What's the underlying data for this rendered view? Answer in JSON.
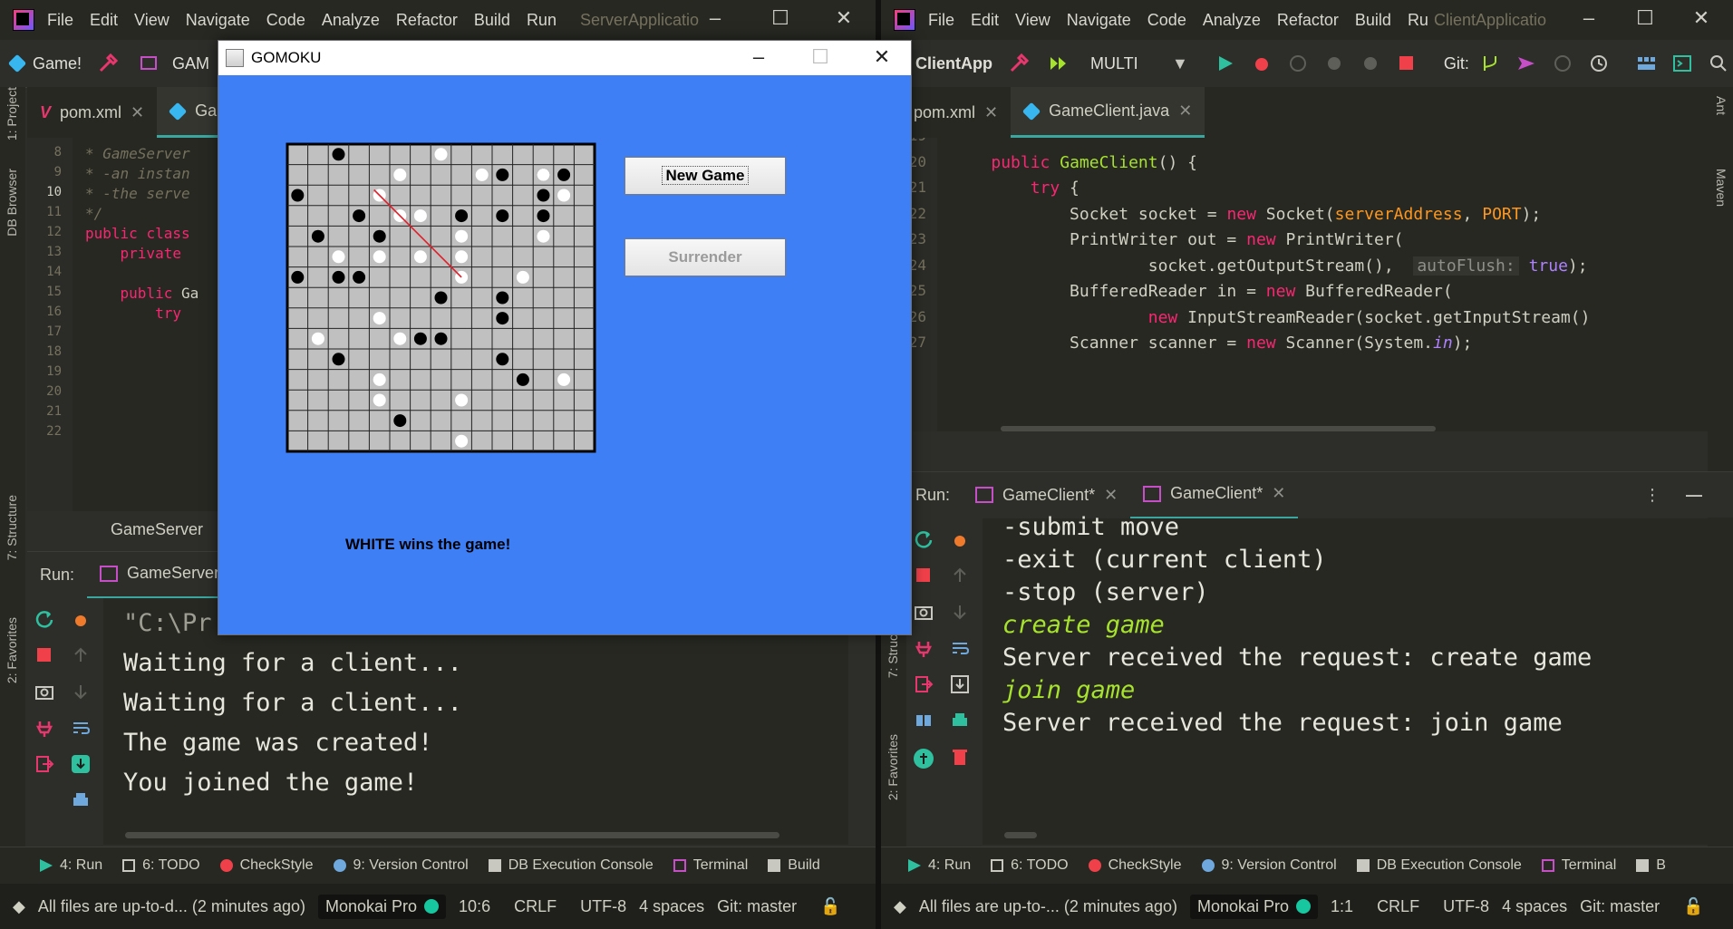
{
  "left_window": {
    "menu": [
      "File",
      "Edit",
      "View",
      "Navigate",
      "Code",
      "Analyze",
      "Refactor",
      "Build",
      "Run"
    ],
    "title": "ServerApplicatio",
    "toolbar": {
      "project": "Game!",
      "config": "GAM"
    },
    "tabs": [
      {
        "label": "pom.xml"
      },
      {
        "label": "Gar"
      }
    ],
    "side_labels": {
      "project": "1: Project",
      "db": "DB Browser",
      "structure": "7: Structure",
      "favorites": "2: Favorites"
    },
    "editor": {
      "line_numbers": [
        "8",
        "9",
        "10",
        "11",
        "12",
        "13",
        "14",
        "15",
        "16",
        "17",
        "18",
        "19",
        "20",
        "21",
        "22"
      ],
      "lines": [
        "* GameServer",
        "* -an instan",
        "* -the serve",
        "*/",
        "public class",
        "    private ",
        "",
        "    public Ga",
        "        try ",
        "",
        "",
        "",
        "",
        "",
        ""
      ],
      "breadcrumb": "GameServer"
    },
    "run": {
      "label": "Run:",
      "tab": "GameServer",
      "console": [
        "\"C:\\Pr",
        "Waiting for a client...",
        "Waiting for a client...",
        "The game was created!",
        "You joined the game!"
      ]
    },
    "toolwindows": [
      "4: Run",
      "6: TODO",
      "CheckStyle",
      "9: Version Control",
      "DB Execution Console",
      "Terminal",
      "Build"
    ],
    "status": {
      "message": "All files are up-to-d... (2 minutes ago)",
      "theme": "Monokai Pro",
      "pos": "10:6",
      "crlf": "CRLF",
      "enc": "UTF-8",
      "indent": "4 spaces",
      "git": "Git: master"
    }
  },
  "right_window": {
    "menu": [
      "File",
      "Edit",
      "View",
      "Navigate",
      "Code",
      "Analyze",
      "Refactor",
      "Build",
      "Ru"
    ],
    "title": "ClientApplicatio",
    "toolbar": {
      "project": "ClientApp",
      "config": "MULTI",
      "git": "Git:"
    },
    "tabs": [
      {
        "label": "pom.xml"
      },
      {
        "label": "GameClient.java"
      }
    ],
    "side_labels": {
      "ant": "Ant",
      "maven": "Maven",
      "structure": "7: Struc",
      "favorites": "2: Favorites"
    },
    "editor": {
      "line_numbers": [
        "19",
        "20",
        "21",
        "22",
        "23",
        "24",
        "25",
        "26",
        "27"
      ],
      "lines": [
        "",
        "    public GameClient() {",
        "        try {",
        "            Socket socket = new Socket(serverAddress, PORT);",
        "            PrintWriter out = new PrintWriter(",
        "                    socket.getOutputStream(),  autoFlush: true);",
        "            BufferedReader in = new BufferedReader(",
        "                    new InputStreamReader(socket.getInputStream()",
        "            Scanner scanner = new Scanner(System.in);"
      ]
    },
    "run": {
      "label": "Run:",
      "tabs": [
        "GameClient*",
        "GameClient*"
      ],
      "console": [
        {
          "text": "-submit move",
          "style": "normal"
        },
        {
          "text": "-exit (current client)",
          "style": "normal"
        },
        {
          "text": "-stop (server)",
          "style": "normal"
        },
        {
          "text": "create game",
          "style": "green"
        },
        {
          "text": "Server received the request: create game",
          "style": "normal"
        },
        {
          "text": "join game",
          "style": "green"
        },
        {
          "text": "Server received the request: join game",
          "style": "normal"
        }
      ]
    },
    "toolwindows": [
      "4: Run",
      "6: TODO",
      "CheckStyle",
      "9: Version Control",
      "DB Execution Console",
      "Terminal",
      "B"
    ],
    "status": {
      "message": "All files are up-to-... (2 minutes ago)",
      "theme": "Monokai Pro",
      "pos": "1:1",
      "crlf": "CRLF",
      "enc": "UTF-8",
      "indent": "4 spaces",
      "git": "Git: master"
    }
  },
  "gomoku": {
    "title": "GOMOKU",
    "new_game_label": "New Game",
    "surrender_label": "Surrender",
    "message": "WHITE wins the game!",
    "board_size": 15,
    "board_color": "#c0c0c0",
    "background_color": "#3f7ff6",
    "black_stones": [
      [
        0,
        2
      ],
      [
        1,
        10
      ],
      [
        1,
        12
      ],
      [
        1,
        13
      ],
      [
        2,
        0
      ],
      [
        2,
        12
      ],
      [
        3,
        3
      ],
      [
        3,
        8
      ],
      [
        3,
        10
      ],
      [
        3,
        12
      ],
      [
        4,
        1
      ],
      [
        4,
        4
      ],
      [
        6,
        0
      ],
      [
        6,
        2
      ],
      [
        6,
        3
      ],
      [
        7,
        7
      ],
      [
        7,
        10
      ],
      [
        8,
        10
      ],
      [
        9,
        6
      ],
      [
        9,
        7
      ],
      [
        10,
        2
      ],
      [
        10,
        10
      ],
      [
        11,
        11
      ],
      [
        13,
        5
      ]
    ],
    "white_stones": [
      [
        0,
        7
      ],
      [
        1,
        5
      ],
      [
        1,
        9
      ],
      [
        1,
        12
      ],
      [
        2,
        4
      ],
      [
        2,
        13
      ],
      [
        3,
        5
      ],
      [
        3,
        6
      ],
      [
        4,
        8
      ],
      [
        4,
        12
      ],
      [
        5,
        2
      ],
      [
        5,
        4
      ],
      [
        5,
        6
      ],
      [
        5,
        8
      ],
      [
        6,
        8
      ],
      [
        6,
        11
      ],
      [
        8,
        4
      ],
      [
        9,
        1
      ],
      [
        9,
        5
      ],
      [
        11,
        4
      ],
      [
        11,
        13
      ],
      [
        12,
        4
      ],
      [
        12,
        8
      ],
      [
        14,
        8
      ]
    ],
    "win_line": {
      "from": [
        2,
        4
      ],
      "to": [
        6,
        8
      ],
      "color": "#e0202a"
    }
  }
}
